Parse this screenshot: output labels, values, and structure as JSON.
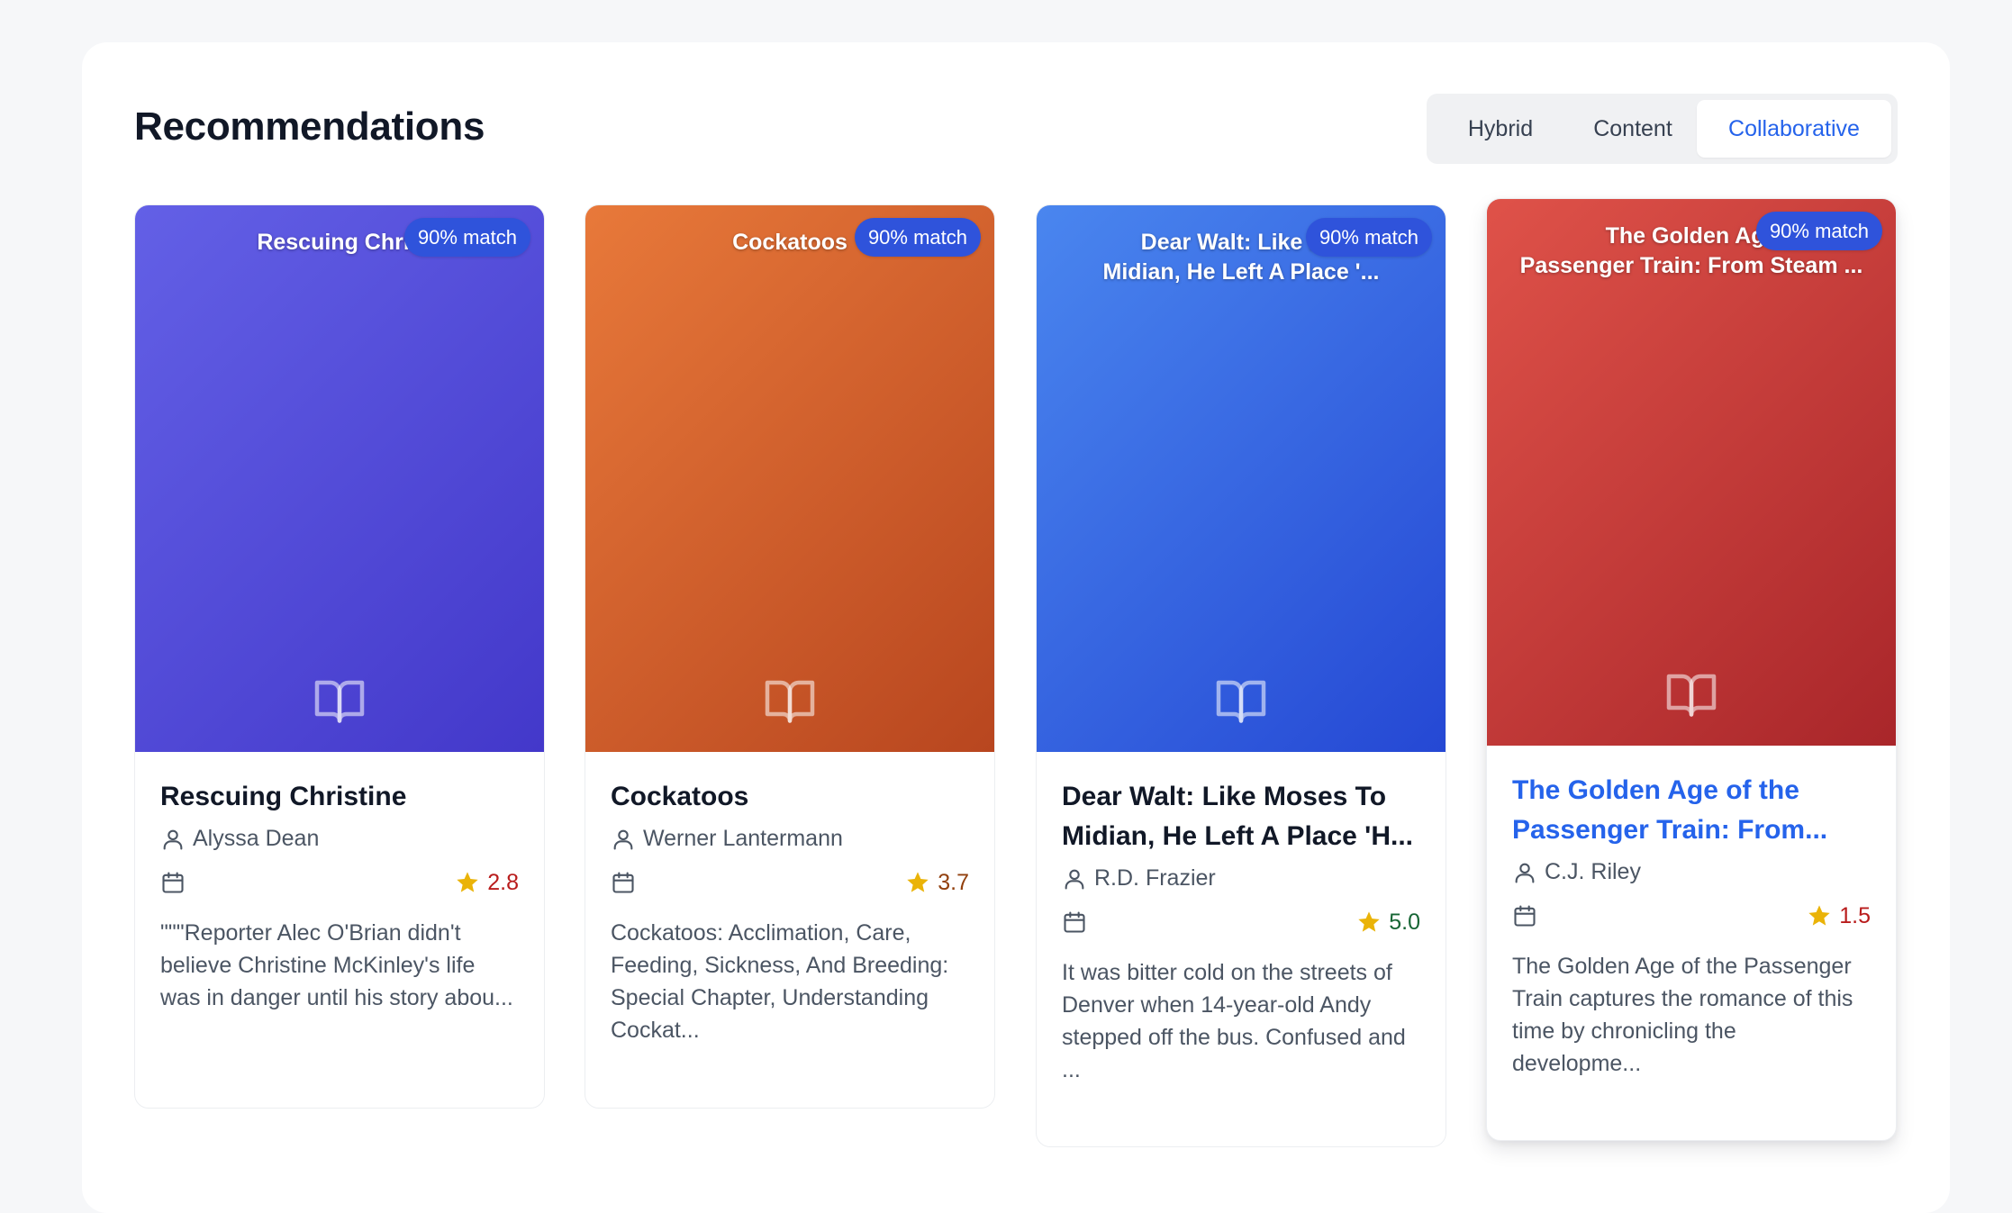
{
  "header": {
    "title": "Recommendations"
  },
  "tabs": [
    {
      "label": "Hybrid",
      "active": false
    },
    {
      "label": "Content",
      "active": false
    },
    {
      "label": "Collaborative",
      "active": true
    }
  ],
  "cards": [
    {
      "cover_title": "Rescuing Chris",
      "badge": "90% match",
      "title": "Rescuing Christine",
      "author": "Alyssa Dean",
      "rating": "2.8",
      "rating_color": "#b91c1c",
      "description": "\"\"\"Reporter Alec O'Brian didn't believe Christine McKinley's life was in danger until his story abou...",
      "gradient": [
        "#6360e6",
        "#4338ca"
      ],
      "icon": "book-open-icon"
    },
    {
      "cover_title": "Cockatoos",
      "badge": "90% match",
      "title": "Cockatoos",
      "author": "Werner Lantermann",
      "rating": "3.7",
      "rating_color": "#92400e",
      "description": "Cockatoos: Acclimation, Care, Feeding, Sickness, And Breeding: Special Chapter, Understanding Cockat...",
      "gradient": [
        "#e8793a",
        "#b8461f"
      ],
      "icon": "book-open-icon"
    },
    {
      "cover_title": "Dear Walt: Like Mo\nMidian, He Left A Place '...",
      "badge": "90% match",
      "title": "Dear Walt: Like Moses To Midian, He Left A Place 'H...",
      "author": "R.D. Frazier",
      "rating": "5.0",
      "rating_color": "#166534",
      "description": "It was bitter cold on the streets of Denver when 14-year-old Andy stepped off the bus. Confused and ...",
      "gradient": [
        "#4a86ef",
        "#2548d4"
      ],
      "icon": "book-open-icon"
    },
    {
      "cover_title": "The Golden Age\nPassenger Train: From Steam ...",
      "badge": "90% match",
      "title": "The Golden Age of the Passenger Train: From...",
      "author": "C.J. Riley",
      "rating": "1.5",
      "rating_color": "#b91c1c",
      "description": "The Golden Age of the Passenger Train captures the romance of this time by chronicling the developme...",
      "gradient": [
        "#df5249",
        "#a9262a"
      ],
      "icon": "book-open-icon"
    }
  ],
  "colors": {
    "accent": "#2563eb",
    "badge": "#2f53db",
    "star": "#eab308"
  }
}
